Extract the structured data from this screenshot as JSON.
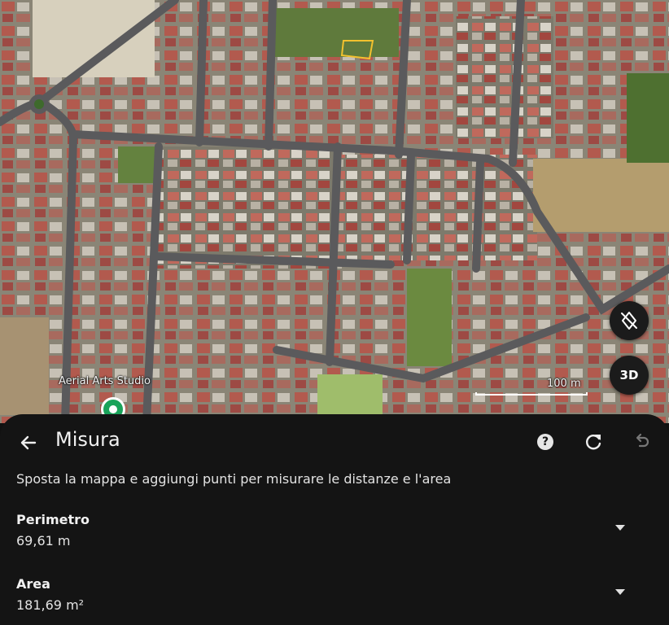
{
  "map": {
    "poi_label": "Aerial Arts Studio",
    "scale_label": "100 m",
    "view_3d_label": "3D",
    "icons": {
      "compass": "compass-off-icon",
      "pin": "location-pin-icon"
    }
  },
  "panel": {
    "title": "Misura",
    "instructions": "Sposta la mappa e aggiungi punti per misurare le distanze e l'area",
    "help_label": "?",
    "icons": {
      "back": "back-arrow-icon",
      "help": "help-icon",
      "refresh": "refresh-icon",
      "undo": "undo-icon",
      "expand": "chevron-down-icon"
    },
    "metrics": [
      {
        "label": "Perimetro",
        "value": "69,61 m"
      },
      {
        "label": "Area",
        "value": "181,69 m²"
      }
    ]
  },
  "colors": {
    "panel_bg": "#141414",
    "pin": "#1aa35a",
    "measure_outline": "#f2c12e"
  }
}
